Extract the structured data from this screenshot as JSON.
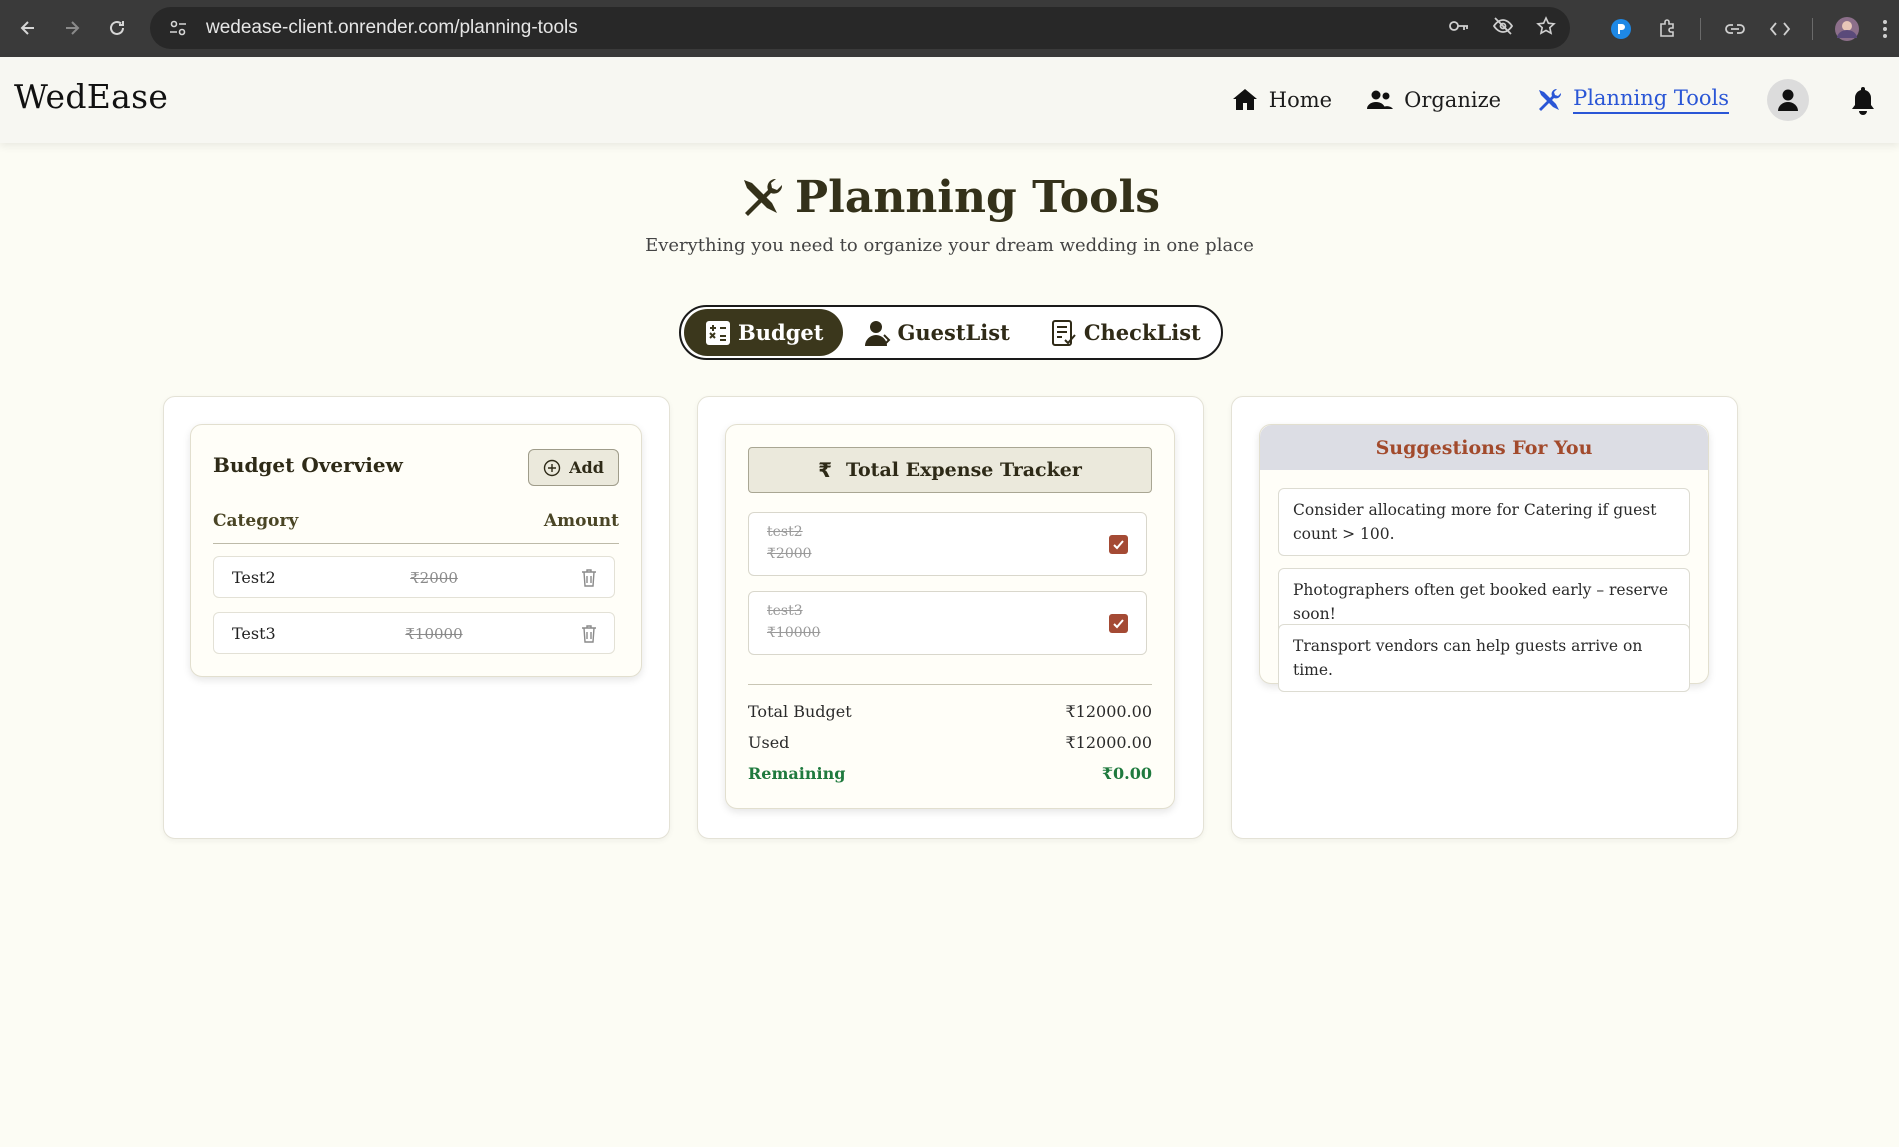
{
  "browser": {
    "url": "wedease-client.onrender.com/planning-tools"
  },
  "header": {
    "brand": "WedEase",
    "nav": [
      {
        "label": "Home",
        "icon": "home-icon"
      },
      {
        "label": "Organize",
        "icon": "users-icon"
      },
      {
        "label": "Planning Tools",
        "icon": "tools-icon",
        "active": true
      }
    ]
  },
  "page": {
    "title": "Planning Tools",
    "subtitle": "Everything you need to organize your dream wedding in one place"
  },
  "tabs": [
    {
      "label": "Budget",
      "active": true
    },
    {
      "label": "GuestList"
    },
    {
      "label": "CheckList"
    }
  ],
  "budget_overview": {
    "title": "Budget Overview",
    "add_label": "Add",
    "col_category": "Category",
    "col_amount": "Amount",
    "rows": [
      {
        "category": "Test2",
        "amount": "₹2000"
      },
      {
        "category": "Test3",
        "amount": "₹10000"
      }
    ]
  },
  "expense_tracker": {
    "title": "Total Expense Tracker",
    "items": [
      {
        "name": "test2",
        "amount": "₹2000",
        "checked": true
      },
      {
        "name": "test3",
        "amount": "₹10000",
        "checked": true
      }
    ],
    "total_label": "Total Budget",
    "total_value": "₹12000.00",
    "used_label": "Used",
    "used_value": "₹12000.00",
    "remaining_label": "Remaining",
    "remaining_value": "₹0.00"
  },
  "suggestions": {
    "title": "Suggestions For You",
    "items": [
      "Consider allocating more for Catering if guest count > 100.",
      "Photographers often get booked early – reserve soon!",
      "Transport vendors can help guests arrive on time."
    ]
  },
  "colors": {
    "accent_dark": "#3b371c",
    "nav_active": "#2a56d6",
    "checkbox": "#a44a34",
    "remaining": "#1f7a3e",
    "suggestion_title": "#a24a2c"
  }
}
